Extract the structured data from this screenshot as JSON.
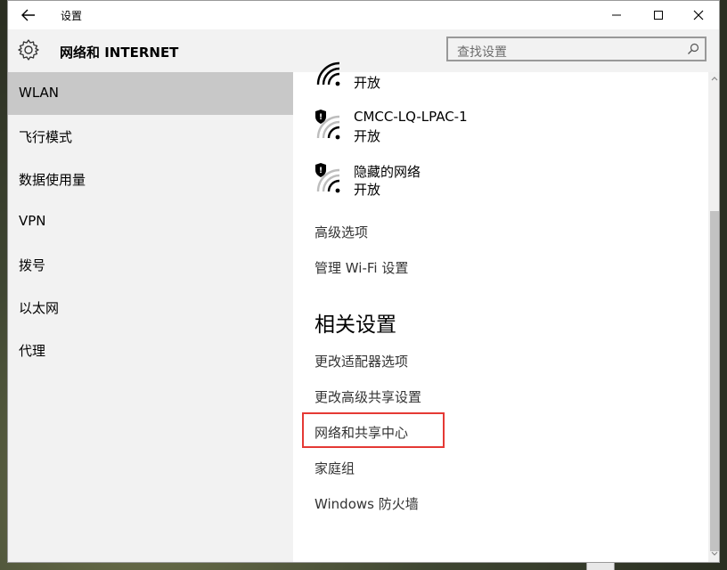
{
  "window": {
    "title": "设置"
  },
  "header": {
    "section_title": "网络和 INTERNET",
    "search_placeholder": "查找设置"
  },
  "sidebar": {
    "items": [
      {
        "label": "WLAN",
        "active": true
      },
      {
        "label": "飞行模式"
      },
      {
        "label": "数据使用量"
      },
      {
        "label": "VPN"
      },
      {
        "label": "拨号"
      },
      {
        "label": "以太网"
      },
      {
        "label": "代理"
      }
    ]
  },
  "networks": [
    {
      "name": "",
      "status": "开放",
      "secured": false
    },
    {
      "name": "CMCC-LQ-LPAC-1",
      "status": "开放",
      "secured": true
    },
    {
      "name": "隐藏的网络",
      "status": "开放",
      "secured": true
    }
  ],
  "links": {
    "advanced": "高级选项",
    "manage_wifi": "管理 Wi-Fi 设置"
  },
  "related": {
    "heading": "相关设置",
    "adapter": "更改适配器选项",
    "sharing": "更改高级共享设置",
    "center": "网络和共享中心",
    "homegroup": "家庭组",
    "firewall": "Windows 防火墙"
  },
  "colors": {
    "highlight": "#e53935",
    "sidebar_active": "#c8c8c8",
    "sidebar_bg": "#f2f2f2"
  },
  "icons": [
    "back-arrow-icon",
    "gear-icon",
    "search-icon",
    "wifi-icon",
    "shield-icon",
    "minimize-icon",
    "maximize-icon",
    "close-icon"
  ]
}
